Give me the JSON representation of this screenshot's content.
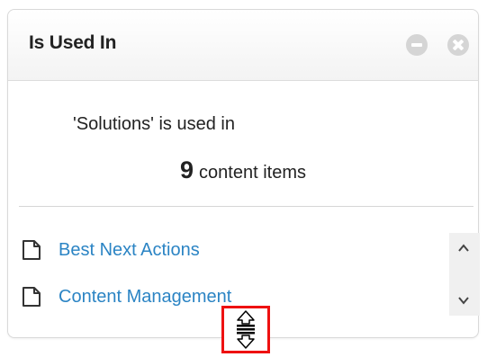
{
  "panel": {
    "title": "Is Used In",
    "header_buttons": {
      "minimize_icon": "minus-circle-icon",
      "close_icon": "x-circle-icon"
    }
  },
  "summary": {
    "used_in_text": "'Solutions' is used in",
    "count": "9",
    "count_label": "content items"
  },
  "items": [
    {
      "label": "Best Next Actions",
      "icon": "document-icon"
    },
    {
      "label": "Content Management",
      "icon": "document-icon"
    }
  ],
  "scrollbar": {
    "up_icon": "chevron-up-icon",
    "down_icon": "chevron-down-icon"
  },
  "cursor": {
    "icon": "vertical-resize-cursor-icon",
    "highlight_color": "#ee1111"
  },
  "colors": {
    "link": "#2b84c4",
    "header_button": "#d5d5d5"
  }
}
